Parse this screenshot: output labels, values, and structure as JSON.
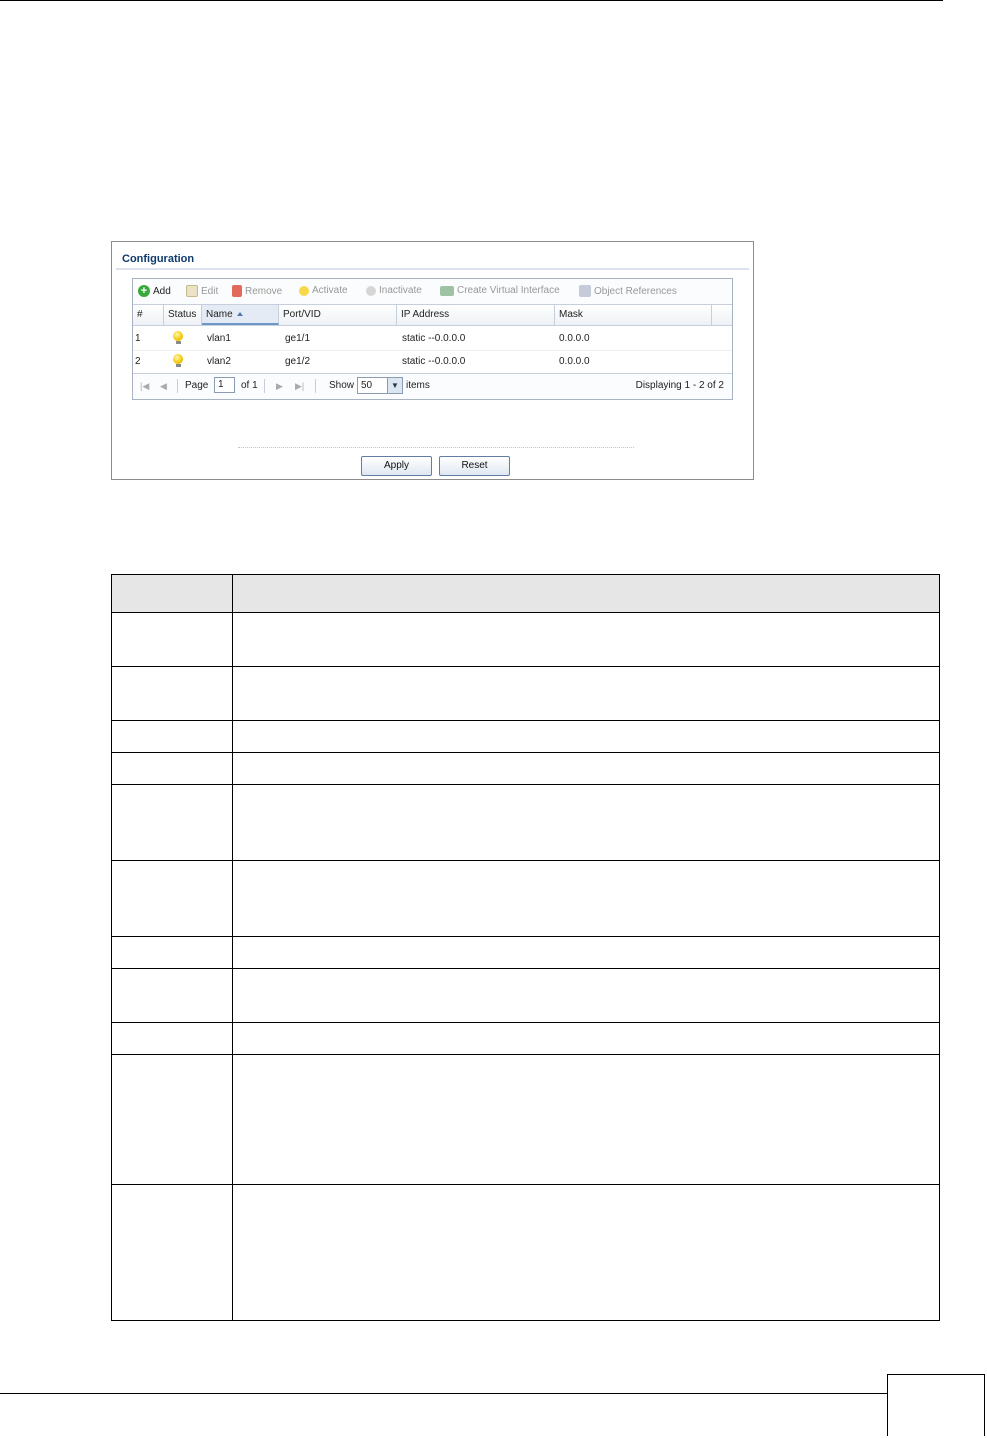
{
  "panel": {
    "title": "Configuration",
    "toolbar": [
      {
        "label": "Add",
        "icon": "add-icon",
        "enabled": true
      },
      {
        "label": "Edit",
        "icon": "edit-icon",
        "enabled": false
      },
      {
        "label": "Remove",
        "icon": "trash-icon",
        "enabled": false
      },
      {
        "label": "Activate",
        "icon": "bulb-on-icon",
        "enabled": false
      },
      {
        "label": "Inactivate",
        "icon": "bulb-off-icon",
        "enabled": false
      },
      {
        "label": "Create Virtual Interface",
        "icon": "virtual-interface-icon",
        "enabled": false
      },
      {
        "label": "Object References",
        "icon": "object-references-icon",
        "enabled": false
      }
    ],
    "columns": [
      "#",
      "Status",
      "Name",
      "Port/VID",
      "IP Address",
      "Mask"
    ],
    "sorted_column": "Name",
    "rows": [
      {
        "num": "1",
        "status": "on",
        "name": "vlan1",
        "port": "ge1/1",
        "ip": "static --0.0.0.0",
        "mask": "0.0.0.0"
      },
      {
        "num": "2",
        "status": "on",
        "name": "vlan2",
        "port": "ge1/2",
        "ip": "static --0.0.0.0",
        "mask": "0.0.0.0"
      }
    ],
    "pager": {
      "page_label": "Page",
      "page_value": "1",
      "of_label": "of 1",
      "show_label": "Show",
      "show_value": "50",
      "items_label": "items",
      "displaying": "Displaying 1 - 2 of 2"
    },
    "apply_label": "Apply",
    "reset_label": "Reset"
  },
  "colors": {
    "title": "#0d3a6b",
    "bulb": "#f4c600",
    "header_bg": "#e6e6e6"
  }
}
